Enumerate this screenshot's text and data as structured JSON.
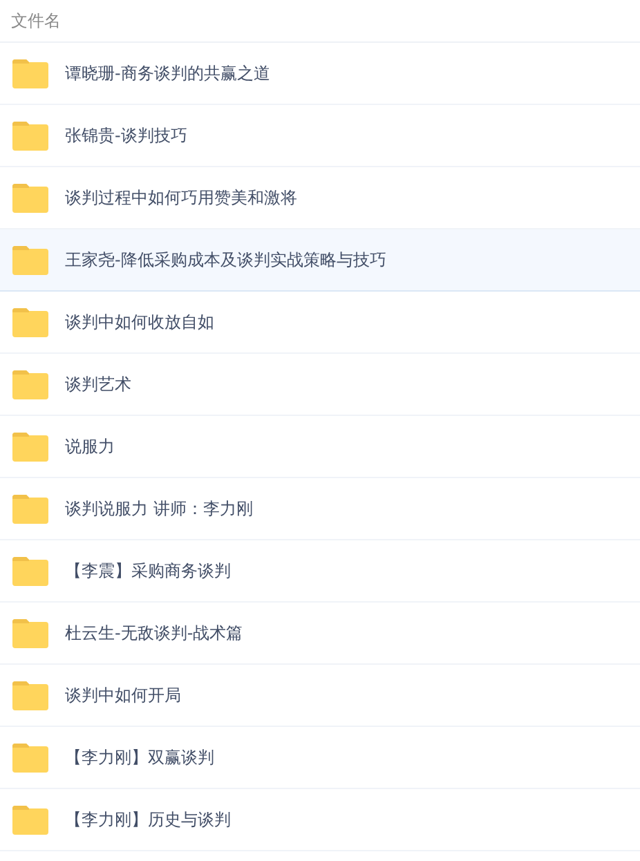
{
  "header": {
    "label": "文件名"
  },
  "files": [
    {
      "name": "谭晓珊-商务谈判的共赢之道",
      "selected": false
    },
    {
      "name": "张锦贵-谈判技巧",
      "selected": false
    },
    {
      "name": "谈判过程中如何巧用赞美和激将",
      "selected": false
    },
    {
      "name": "王家尧-降低采购成本及谈判实战策略与技巧",
      "selected": true
    },
    {
      "name": "谈判中如何收放自如",
      "selected": false
    },
    {
      "name": "谈判艺术",
      "selected": false
    },
    {
      "name": "说服力",
      "selected": false
    },
    {
      "name": "谈判说服力 讲师：李力刚",
      "selected": false
    },
    {
      "name": "【李震】采购商务谈判",
      "selected": false
    },
    {
      "name": "杜云生-无敌谈判-战术篇",
      "selected": false
    },
    {
      "name": "谈判中如何开局",
      "selected": false
    },
    {
      "name": "【李力刚】双赢谈判",
      "selected": false
    },
    {
      "name": "【李力刚】历史与谈判",
      "selected": false
    }
  ]
}
